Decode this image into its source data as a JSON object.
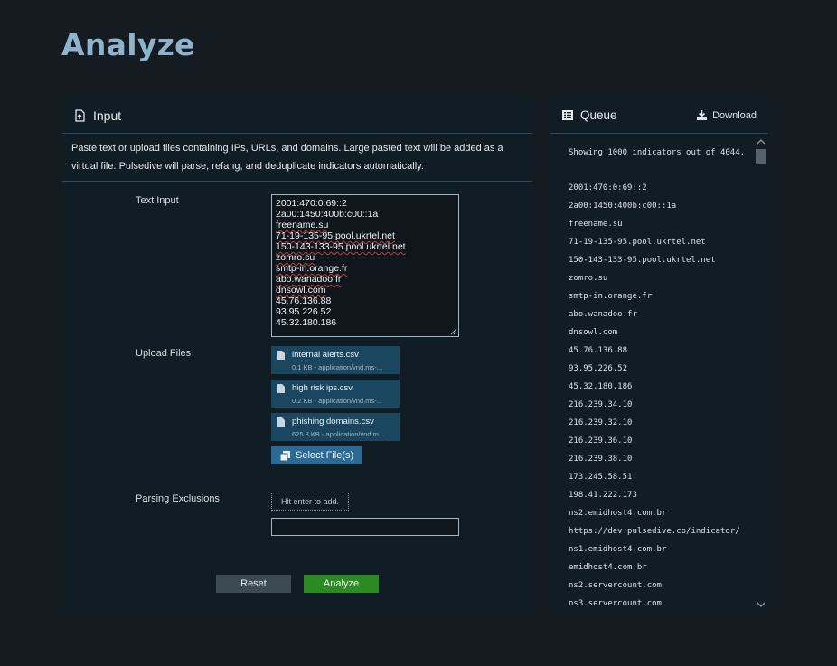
{
  "page": {
    "title": "Analyze"
  },
  "input_panel": {
    "title": "Input",
    "icon": "file-upload-icon",
    "description": "Paste text or upload files containing IPs, URLs, and domains. Large pasted text will be added as a virtual file. Pulsedive will parse, refang, and deduplicate indicators automatically.",
    "text_input_label": "Text Input",
    "text_input_lines": [
      "2001:470:0:69::2",
      "2a00:1450:400b:c00::1a",
      "freename.su",
      "71-19-135-95.pool.ukrtel.net",
      "150-143-133-95.pool.ukrtel.net",
      "zomro.su",
      "smtp-in.orange.fr",
      "abo.wanadoo.fr",
      "dnsowl.com",
      "45.76.136.88",
      "93.95.226.52",
      "45.32.180.186"
    ],
    "upload_label": "Upload Files",
    "files": [
      {
        "name": "internal alerts.csv",
        "meta": "0.1 KB - application/vnd.ms-..."
      },
      {
        "name": "high risk ips.csv",
        "meta": "0.2 KB - application/vnd.ms-..."
      },
      {
        "name": "phishing domains.csv",
        "meta": "625.8 KB - application/vnd.m..."
      }
    ],
    "select_files_label": "Select File(s)",
    "exclusions_label": "Parsing Exclusions",
    "exclusions_placeholder": "Hit enter to add.",
    "reset_label": "Reset",
    "analyze_label": "Analyze"
  },
  "queue_panel": {
    "title": "Queue",
    "icon": "list-icon",
    "download_label": "Download",
    "summary": "Showing 1000 indicators out of 4044.",
    "items": [
      "2001:470:0:69::2",
      "2a00:1450:400b:c00::1a",
      "freename.su",
      "71-19-135-95.pool.ukrtel.net",
      "150-143-133-95.pool.ukrtel.net",
      "zomro.su",
      "smtp-in.orange.fr",
      "abo.wanadoo.fr",
      "dnsowl.com",
      "45.76.136.88",
      "93.95.226.52",
      "45.32.180.186",
      "216.239.34.10",
      "216.239.32.10",
      "216.239.36.10",
      "216.239.38.10",
      "173.245.58.51",
      "198.41.222.173",
      "ns2.emidhost4.com.br",
      "https://dev.pulsedive.co/indicator/",
      "ns1.emidhost4.com.br",
      "emidhost4.com.br",
      "ns2.servercount.com",
      "ns3.servercount.com"
    ]
  },
  "colors": {
    "background": "#141c22",
    "panel": "#111d24",
    "title": "#8fb3cc",
    "file_chip": "#1b4660",
    "primary_button": "#2a6a95",
    "analyze_button": "#2c8a22",
    "reset_button": "#3b4a53"
  }
}
